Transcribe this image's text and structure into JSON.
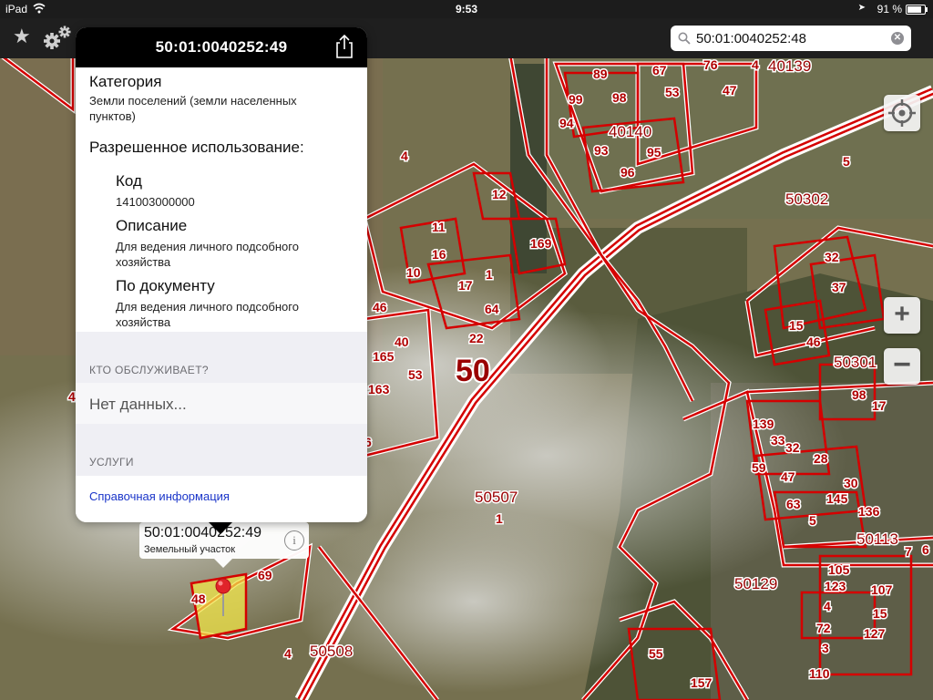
{
  "status_bar": {
    "device": "iPad",
    "time": "9:53",
    "battery_text": "91 %",
    "battery_level": 0.91
  },
  "toolbar": {
    "favorites_icon": "star-icon",
    "settings_icon": "gear-icon",
    "search": {
      "value": "50:01:0040252:48",
      "icon": "search-icon",
      "clear_icon": "clear-icon"
    }
  },
  "popover": {
    "title": "50:01:0040252:49",
    "share_icon": "share-icon",
    "category": {
      "label": "Категория",
      "value": "Земли поселений (земли населенных пунктов)"
    },
    "permitted_use": {
      "label": "Разрешенное использование:",
      "code_label": "Код",
      "code_value": "141003000000",
      "description_label": "Описание",
      "description_value": "Для ведения личного подсобного хозяйства",
      "by_document_label": "По документу",
      "by_document_value": "Для ведения личного подсобного хозяйства"
    },
    "serviced_by": {
      "header": "КТО ОБСЛУЖИВАЕТ?",
      "value": "Нет данных..."
    },
    "services": {
      "header": "УСЛУГИ",
      "link": "Справочная информация"
    }
  },
  "callout": {
    "title": "50:01:0040252:49",
    "subtitle": "Земельный участок",
    "info_icon": "info-icon"
  },
  "map": {
    "boundary_color": "#d40000",
    "highlight_color": "#f2e64a",
    "road_label": "50",
    "block_labels": [
      "40139",
      "40140",
      "50302",
      "50301",
      "50507",
      "50113",
      "50129",
      "50508"
    ],
    "parcel_labels": [
      "89",
      "67",
      "76",
      "4",
      "99",
      "98",
      "53",
      "47",
      "94",
      "93",
      "96",
      "95",
      "4",
      "5",
      "12",
      "11",
      "16",
      "10",
      "169",
      "17",
      "1",
      "64",
      "22",
      "32",
      "37",
      "15",
      "46",
      "46",
      "40",
      "165",
      "53",
      "163",
      "6",
      "46",
      "98",
      "17",
      "139",
      "33",
      "32",
      "59",
      "28",
      "47",
      "30",
      "63",
      "145",
      "136",
      "5",
      "7",
      "105",
      "123",
      "107",
      "4",
      "15",
      "72",
      "127",
      "3",
      "110",
      "55",
      "157",
      "48",
      "69",
      "4",
      "1",
      "6"
    ]
  }
}
